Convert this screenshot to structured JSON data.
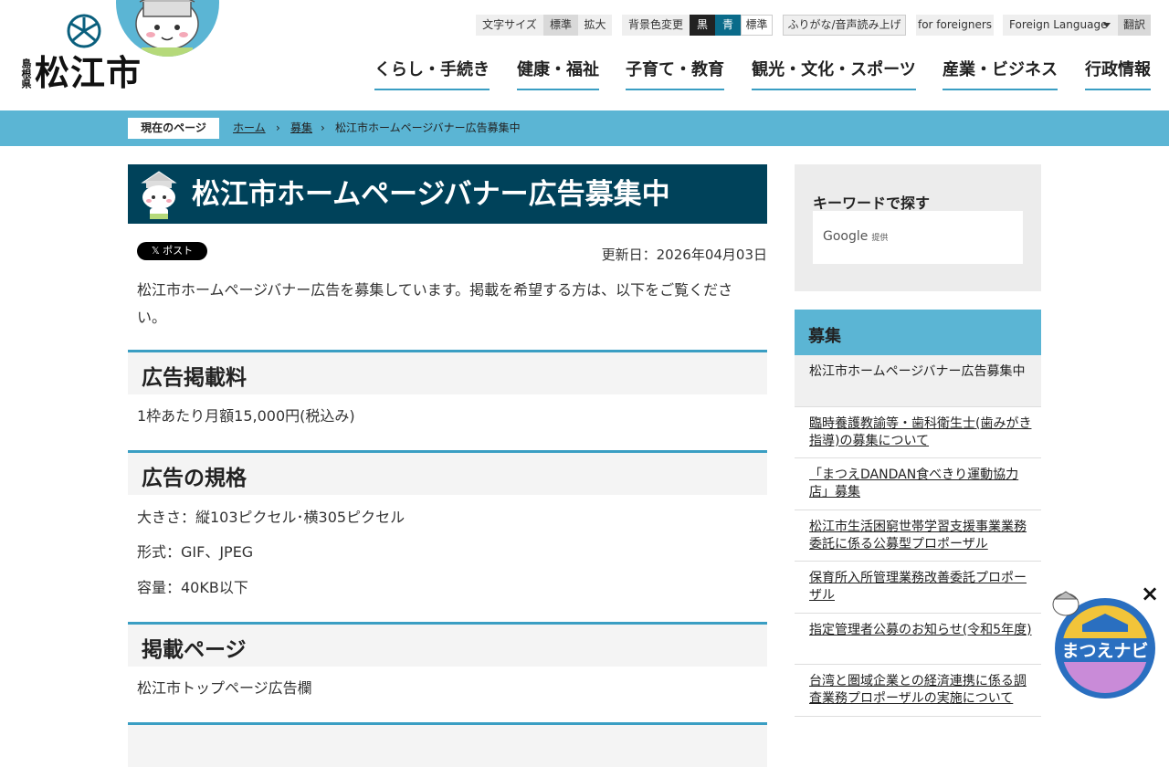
{
  "header": {
    "prefecture": "島根県",
    "city": "松江市",
    "toolbar": {
      "font_size_label": "文字サイズ",
      "font_standard": "標準",
      "font_large": "拡大",
      "bg_label": "背景色変更",
      "bg_black": "黒",
      "bg_blue": "青",
      "bg_standard": "標準",
      "furigana": "ふりがな/音声読み上げ",
      "foreigners": "for foreigners",
      "foreign_language": "Foreign Language",
      "translate": "翻訳"
    },
    "nav": [
      "くらし・手続き",
      "健康・福祉",
      "子育て・教育",
      "観光・文化・スポーツ",
      "産業・ビジネス",
      "行政情報"
    ]
  },
  "breadcrumb": {
    "label": "現在のページ",
    "items": [
      "ホーム",
      "募集",
      "松江市ホームページバナー広告募集中"
    ]
  },
  "main": {
    "title": "松江市ホームページバナー広告募集中",
    "post_button": "ポスト",
    "updated": "更新日：2026年04月03日",
    "lead": "松江市ホームページバナー広告を募集しています。掲載を希望する方は、以下をご覧ください。",
    "sections": [
      {
        "heading": "広告掲載料",
        "lines": [
          "1枠あたり月額15,000円(税込み)"
        ]
      },
      {
        "heading": "広告の規格",
        "lines": [
          "大きさ：縦103ピクセル･横305ピクセル",
          "形式：GIF、JPEG",
          "容量：40KB以下"
        ]
      },
      {
        "heading": "掲載ページ",
        "lines": [
          "松江市トップページ広告欄"
        ]
      }
    ]
  },
  "sidebar": {
    "search_title": "キーワードで探す",
    "google_text": "Google",
    "google_provided": "提供",
    "category": "募集",
    "items": [
      "松江市ホームページバナー広告募集中",
      "臨時養護教諭等・歯科衛生士(歯みがき指導)の募集について",
      "「まつえDANDAN食べきり運動協力店」募集",
      "松江市生活困窮世帯学習支援事業業務委託に係る公募型プロポーザル",
      "保育所入所管理業務改善委託プロポーザル",
      "指定管理者公募のお知らせ(令和5年度)",
      "台湾と圏域企業との経済連携に係る調査業務プロポーザルの実施について"
    ]
  },
  "floating": {
    "navi_label": "まつえナビ",
    "close": "×"
  },
  "colors": {
    "accent": "#5bb5d4",
    "title_bg": "#00425a",
    "heading_border": "#3a9ec3"
  }
}
